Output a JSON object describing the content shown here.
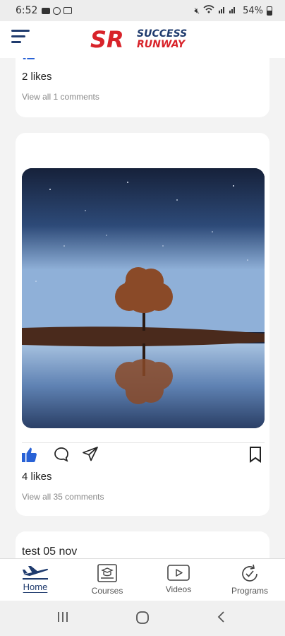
{
  "status_bar": {
    "time": "6:52",
    "battery": "54%"
  },
  "header": {
    "logo_mark": "SR",
    "logo_line1": "SUCCESS",
    "logo_line2": "RUNWAY"
  },
  "posts": [
    {
      "likes": "2 likes",
      "comments": "View all 1 comments"
    },
    {
      "likes": "4 likes",
      "comments": "View all 35 comments"
    },
    {
      "title": "test 05 nov"
    }
  ],
  "bottom_nav": [
    {
      "label": "Home",
      "icon": "plane-icon"
    },
    {
      "label": "Courses",
      "icon": "courses-icon"
    },
    {
      "label": "Videos",
      "icon": "video-icon"
    },
    {
      "label": "Programs",
      "icon": "programs-icon"
    }
  ],
  "colors": {
    "brand_blue": "#1f3b6e",
    "brand_red": "#d8232a",
    "like_blue": "#2962d6"
  }
}
